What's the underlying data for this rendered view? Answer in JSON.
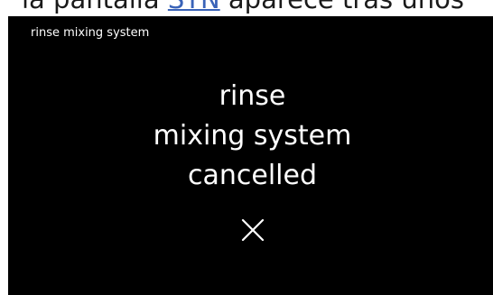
{
  "background_doc": {
    "text_before": "la pantalla ",
    "link_text": "SYN",
    "text_after": " aparece tras unos"
  },
  "screen": {
    "title": "rinse mixing system",
    "message_lines": [
      "rinse",
      "mixing system",
      "cancelled"
    ],
    "close_icon": "close-icon"
  },
  "colors": {
    "screen_background": "#000000",
    "screen_text": "#ffffff",
    "link": "#3a63b8"
  }
}
